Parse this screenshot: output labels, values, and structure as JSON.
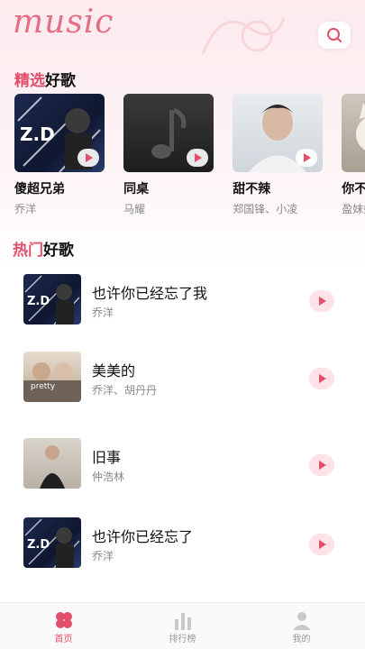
{
  "header": {
    "logo_text": "music",
    "search_icon": "search-icon"
  },
  "featured": {
    "title_accent": "精选",
    "title_rest": "好歌",
    "items": [
      {
        "title": "傻超兄弟",
        "artist": "乔洋",
        "cover_icon": "album-cover-zd"
      },
      {
        "title": "同桌",
        "artist": "马耀",
        "cover_icon": "music-note-placeholder"
      },
      {
        "title": "甜不辣",
        "artist": "郑国锋、小凌",
        "cover_icon": "album-cover-portrait"
      },
      {
        "title": "你不知",
        "artist": "盈妹妹",
        "cover_icon": "album-cover-cat"
      }
    ]
  },
  "hot": {
    "title_accent": "热门",
    "title_rest": "好歌",
    "items": [
      {
        "title": "也许你已经忘了我",
        "artist": "乔洋",
        "cover_icon": "album-cover-zd"
      },
      {
        "title": "美美的",
        "artist": "乔洋、胡丹丹",
        "cover_icon": "album-cover-pretty",
        "cover_text": "pretty"
      },
      {
        "title": "旧事",
        "artist": "仲浩林",
        "cover_icon": "album-cover-portrait"
      },
      {
        "title": "也许你已经忘了",
        "artist": "乔洋",
        "cover_icon": "album-cover-zd"
      }
    ]
  },
  "tabbar": {
    "items": [
      {
        "label": "首页",
        "icon": "home-clover-icon",
        "active": true
      },
      {
        "label": "排行榜",
        "icon": "chart-bars-icon",
        "active": false
      },
      {
        "label": "我的",
        "icon": "user-icon",
        "active": false
      }
    ]
  },
  "colors": {
    "accent": "#e34f6a",
    "logo": "#e36f86",
    "muted_text": "#888888"
  }
}
